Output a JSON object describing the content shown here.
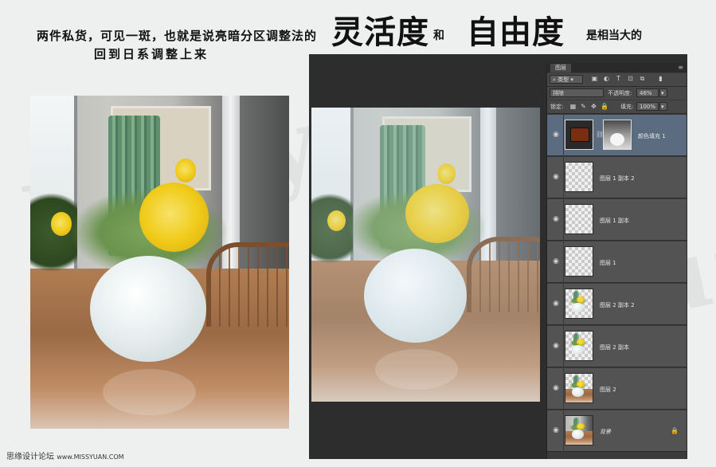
{
  "headline": {
    "line1_prefix": "两件私货，可见一斑，也就是说亮暗分区调整法的",
    "big1": "灵活度",
    "mid": "和",
    "big2": "自由度",
    "line1_suffix": "是相当大的",
    "line2": "回到日系调整上来"
  },
  "layers_panel": {
    "tab_label": "图层",
    "menu_icon": "panel-menu-icon",
    "filter_kind": "类型",
    "blend_mode": "排除",
    "opacity_label": "不透明度:",
    "opacity_value": "46%",
    "lock_label": "锁定:",
    "fill_label": "填充:",
    "fill_value": "100%",
    "fill_color": "#7a2e10",
    "layers": [
      {
        "name": "颜色填充 1",
        "type": "fill",
        "selected": true
      },
      {
        "name": "图层 1 副本 2",
        "type": "transparent"
      },
      {
        "name": "图层 1 副本",
        "type": "transparent"
      },
      {
        "name": "图层 1",
        "type": "transparent"
      },
      {
        "name": "图层 2 副本 2",
        "type": "photo"
      },
      {
        "name": "图层 2 副本",
        "type": "photo"
      },
      {
        "name": "图层 2",
        "type": "photo"
      },
      {
        "name": "背景",
        "type": "background",
        "locked": true
      }
    ]
  },
  "footer": {
    "site_cn": "思缘设计论坛",
    "site_url": "www.MISSYUAN.COM"
  },
  "watermark": "missyuan"
}
